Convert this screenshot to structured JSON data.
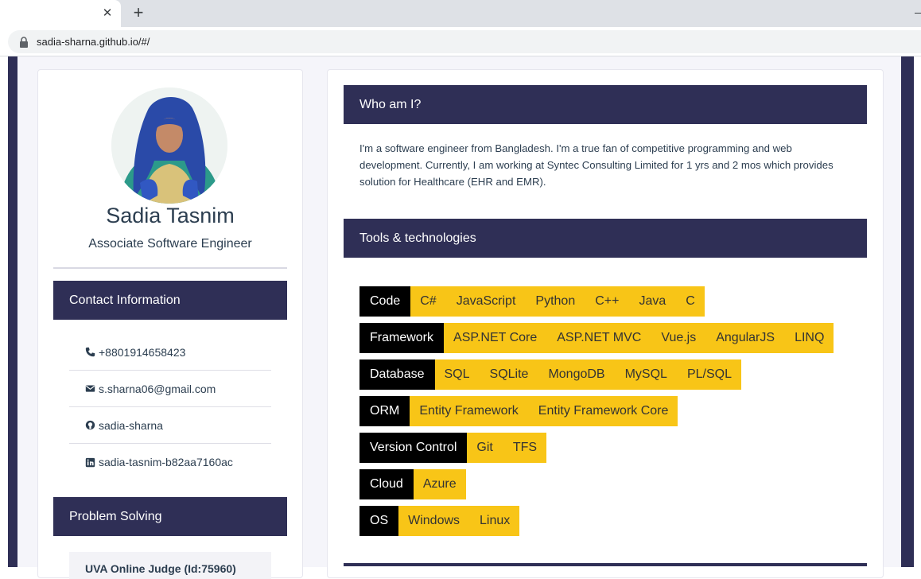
{
  "browser": {
    "url": "sadia-sharna.github.io/#/",
    "close_glyph": "✕",
    "new_tab_glyph": "+"
  },
  "profile": {
    "name": "Sadia Tasnim",
    "role": "Associate Software Engineer"
  },
  "contact": {
    "heading": "Contact Information",
    "items": [
      {
        "icon": "phone-icon",
        "text": "+8801914658423"
      },
      {
        "icon": "envelope-icon",
        "text": "s.sharna06@gmail.com"
      },
      {
        "icon": "github-icon",
        "text": "sadia-sharna"
      },
      {
        "icon": "linkedin-icon",
        "text": "sadia-tasnim-b82aa7160ac"
      }
    ]
  },
  "problem_solving": {
    "heading": "Problem Solving",
    "first_item": "UVA Online Judge (Id:75960)"
  },
  "about": {
    "heading": "Who am I?",
    "text": "I'm a software engineer from Bangladesh. I'm a true fan of competitive programming and web development. Currently, I am working at Syntec Consulting Limited for 1 yrs and 2 mos which provides solution for Healthcare (EHR and EMR)."
  },
  "tools": {
    "heading": "Tools & technologies",
    "rows": [
      {
        "label": "Code",
        "items": [
          "C#",
          "JavaScript",
          "Python",
          "C++",
          "Java",
          "C"
        ]
      },
      {
        "label": "Framework",
        "items": [
          "ASP.NET Core",
          "ASP.NET MVC",
          "Vue.js",
          "AngularJS",
          "LINQ"
        ]
      },
      {
        "label": "Database",
        "items": [
          "SQL",
          "SQLite",
          "MongoDB",
          "MySQL",
          "PL/SQL"
        ]
      },
      {
        "label": "ORM",
        "items": [
          "Entity Framework",
          "Entity Framework Core"
        ]
      },
      {
        "label": "Version Control",
        "items": [
          "Git",
          "TFS"
        ]
      },
      {
        "label": "Cloud",
        "items": [
          "Azure"
        ]
      },
      {
        "label": "OS",
        "items": [
          "Windows",
          "Linux"
        ]
      }
    ]
  },
  "colors": {
    "header_bg": "#2f2f56",
    "tag_label_bg": "#000000",
    "tag_items_bg": "#f8c517"
  }
}
